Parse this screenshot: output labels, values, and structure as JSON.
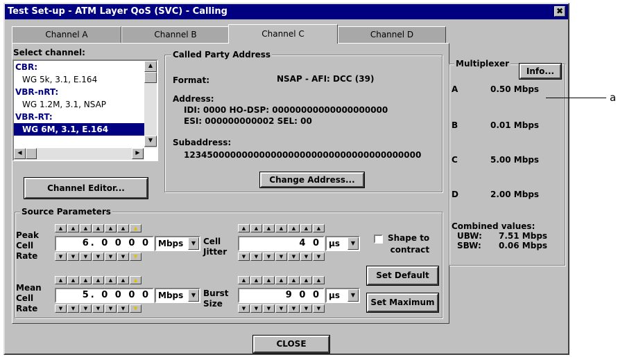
{
  "window": {
    "title": "Test Set-up - ATM Layer QoS (SVC) - Calling",
    "close_glyph": "✖"
  },
  "tabs": [
    {
      "label": "Channel A"
    },
    {
      "label": "Channel B"
    },
    {
      "label": "Channel C"
    },
    {
      "label": "Channel D"
    }
  ],
  "select_channel": {
    "label": "Select channel:",
    "items": [
      {
        "text": "CBR:"
      },
      {
        "text": "WG 5k, 3.1, E.164"
      },
      {
        "text": "VBR-nRT:"
      },
      {
        "text": "WG 1.2M, 3.1, NSAP"
      },
      {
        "text": "VBR-RT:"
      },
      {
        "text": "WG 6M, 3.1, E.164"
      }
    ]
  },
  "channel_editor_label": "Channel Editor...",
  "called_party": {
    "group_label": "Called Party Address",
    "format_label": "Format:",
    "format_value": "NSAP - AFI:  DCC (39)",
    "address_label": "Address:",
    "address_line1": "IDI: 0000   HO-DSP: 00000000000000000000",
    "address_line2": "ESI: 000000000002   SEL: 00",
    "subaddress_label": "Subaddress:",
    "subaddress_value": "12345000000000000000000000000000000000000",
    "change_button": "Change Address..."
  },
  "source_params": {
    "group_label": "Source Parameters",
    "pcr_label_1": "Peak",
    "pcr_label_2": "Cell",
    "pcr_label_3": "Rate",
    "pcr_value": "6. 0 0 0 0",
    "pcr_unit": "Mbps",
    "mcr_label_1": "Mean",
    "mcr_label_2": "Cell",
    "mcr_label_3": "Rate",
    "mcr_value": "5. 0 0 0 0",
    "mcr_unit": "Mbps",
    "cdv_label_1": "Cell",
    "cdv_label_2": "Jitter",
    "cdv_value": "4 0",
    "cdv_unit": "µs",
    "mbs_label_1": "Burst",
    "mbs_label_2": "Size",
    "mbs_value": "9 0 0",
    "mbs_unit": "µs",
    "shape_label_1": "Shape to",
    "shape_label_2": "contract",
    "set_default": "Set Default",
    "set_maximum": "Set Maximum"
  },
  "multiplexer": {
    "label": "Multiplexer",
    "info_button": "Info...",
    "channels": [
      {
        "name": "A",
        "rate": "0.50 Mbps"
      },
      {
        "name": "B",
        "rate": "0.01 Mbps"
      },
      {
        "name": "C",
        "rate": "5.00 Mbps"
      },
      {
        "name": "D",
        "rate": "2.00 Mbps"
      }
    ],
    "combined_label": "Combined values:",
    "ubw_label": "UBW:",
    "ubw_value": "7.51 Mbps",
    "sbw_label": "SBW:",
    "sbw_value": "0.06 Mbps"
  },
  "close_button": "CLOSE",
  "callout": "a"
}
